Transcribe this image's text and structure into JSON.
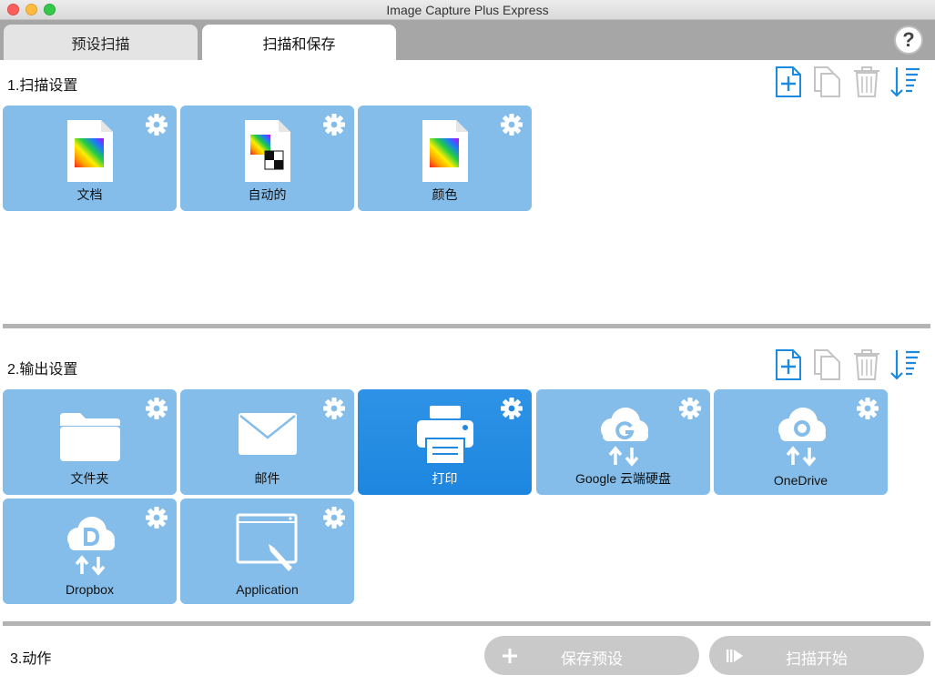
{
  "window": {
    "title": "Image Capture Plus Express"
  },
  "tabs": [
    {
      "label": "预设扫描"
    },
    {
      "label": "扫描和保存"
    }
  ],
  "help": {
    "label": "?"
  },
  "scan_settings": {
    "title": "1.扫描设置",
    "items": [
      {
        "label": "文档"
      },
      {
        "label": "自动的"
      },
      {
        "label": "颜色"
      }
    ]
  },
  "output_settings": {
    "title": "2.输出设置",
    "items": [
      {
        "label": "文件夹"
      },
      {
        "label": "邮件"
      },
      {
        "label": "打印"
      },
      {
        "label": "Google 云端硬盘"
      },
      {
        "label": "OneDrive"
      },
      {
        "label": "Dropbox"
      },
      {
        "label": "Application"
      }
    ]
  },
  "actions": {
    "title": "3.动作",
    "save_preset_label": "保存预设",
    "start_scan_label": "扫描开始"
  },
  "colors": {
    "tile": "#85bdea",
    "tile_selected": "#1f89e0",
    "toolbar_accent": "#1c8ade",
    "disabled_button": "#c9c9c9"
  }
}
